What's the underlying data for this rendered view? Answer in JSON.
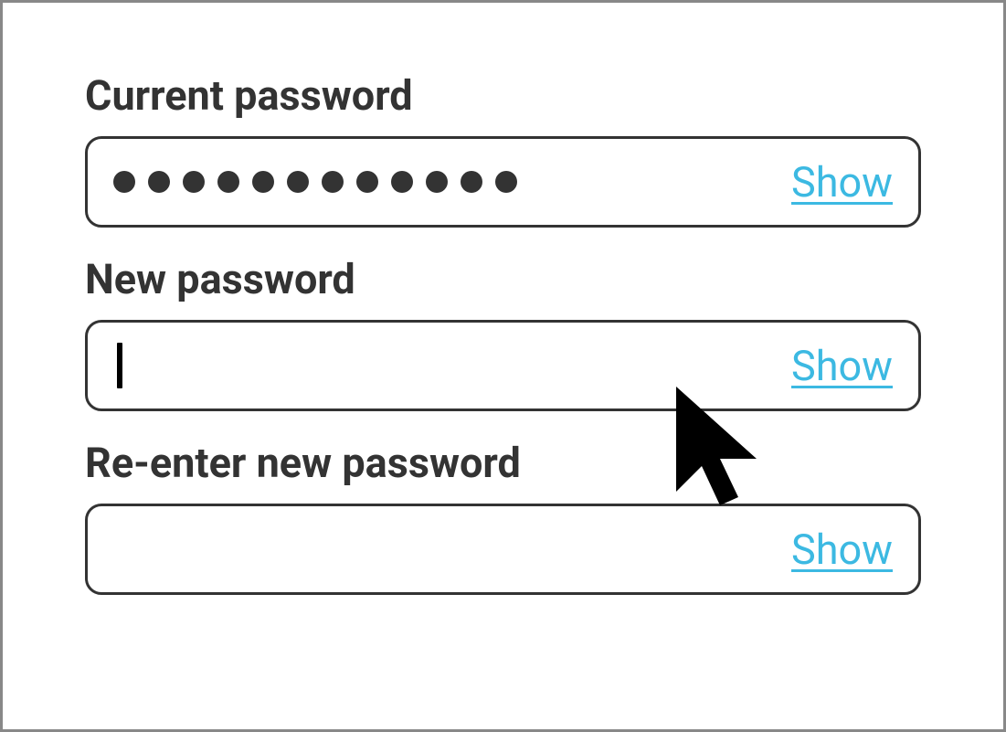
{
  "fields": {
    "current": {
      "label": "Current password",
      "show_label": "Show",
      "masked_length": 12
    },
    "new": {
      "label": "New password",
      "show_label": "Show",
      "value": ""
    },
    "reenter": {
      "label": "Re-enter new password",
      "show_label": "Show",
      "value": ""
    }
  },
  "colors": {
    "link": "#3cb9e2",
    "text": "#333333",
    "border": "#333333",
    "frame": "#888888"
  }
}
